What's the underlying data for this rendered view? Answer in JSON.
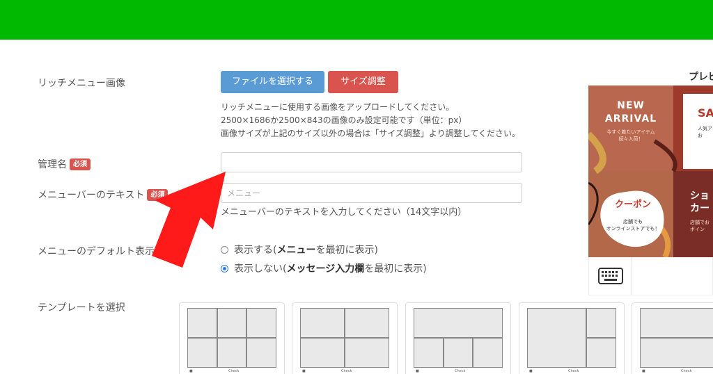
{
  "form": {
    "rich_menu_image_label": "リッチメニュー画像",
    "file_button": "ファイルを選択する",
    "resize_button": "サイズ調整",
    "image_help": [
      "リッチメニューに使用する画像をアップロードしてください。",
      "2500×1686か2500×843の画像のみ設定可能です（単位：px）",
      "画像サイズが上記のサイズ以外の場合は「サイズ調整」より調整してください。"
    ],
    "management_name_label": "管理名",
    "required_badge": "必須",
    "management_name_value": "",
    "menubar_text_label": "メニューバーのテキスト",
    "menubar_text_placeholder": "メニュー",
    "menubar_text_help": "メニューバーのテキストを入力してください（14文字以内）",
    "default_display_label": "メニューのデフォルト表示",
    "radio_show": {
      "prefix": "表示する(",
      "bold": "メニュー",
      "suffix": "を最初に表示)"
    },
    "radio_hide": {
      "prefix": "表示しない(",
      "bold": "メッセージ入力欄",
      "suffix": "を最初に表示)"
    },
    "selected_default": "hide",
    "template_label": "テンプレートを選択",
    "template_check_text": "Check"
  },
  "preview": {
    "title": "プレビュー",
    "panels": {
      "new_arrival_title": [
        "NEW",
        "ARRIVAL"
      ],
      "new_arrival_sub": [
        "今すぐ着たいアイテム",
        "続々入荷！"
      ],
      "sale_title": "SA",
      "sale_sub": [
        "人気ア",
        "お"
      ],
      "coupon_title": "クーポン",
      "coupon_sub": [
        "店舗でも",
        "オンラインストアでも！"
      ],
      "shop_title": [
        "ショ",
        "カー"
      ],
      "shop_sub": [
        "店舗でお",
        "ポイン"
      ]
    },
    "keyboard_icon": "keyboard-icon"
  },
  "colors": {
    "topbar": "#00b900",
    "button_blue": "#5b9bd5",
    "button_red": "#d9534f",
    "arrow": "#ff1a1a"
  }
}
